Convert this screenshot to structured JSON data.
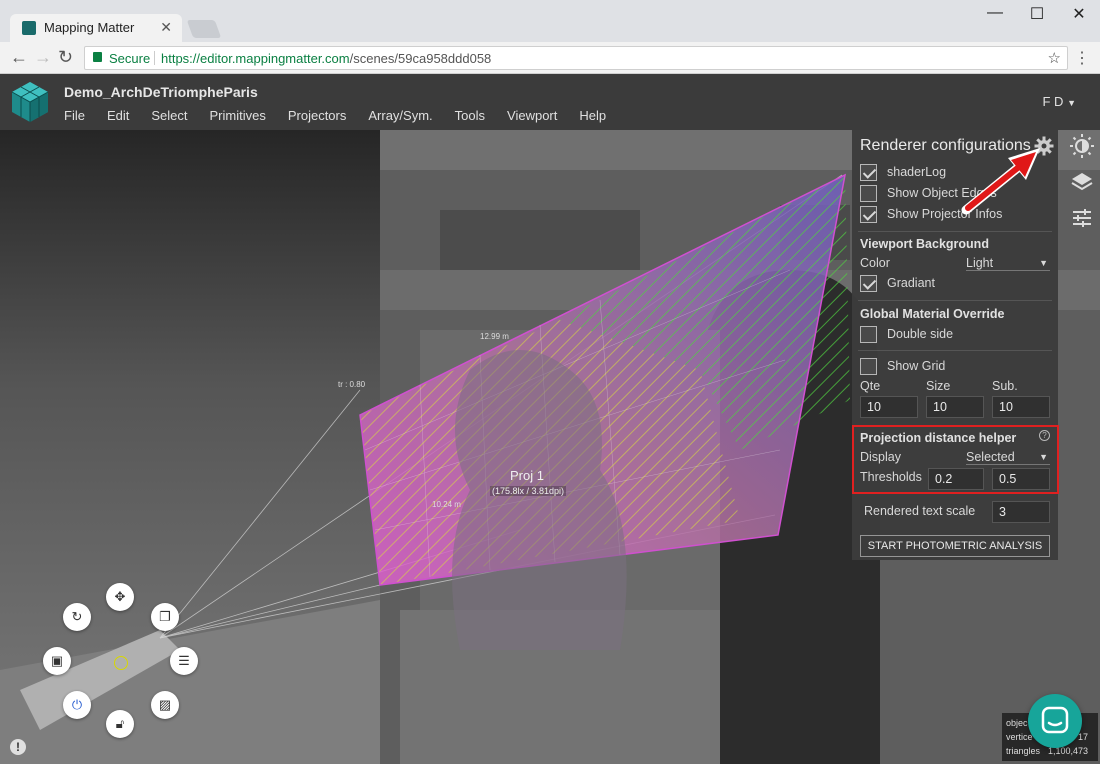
{
  "browser": {
    "tab_title": "Mapping Matter",
    "secure_label": "Secure",
    "url_host": "https://editor.mappingmatter.com",
    "url_path": "/scenes/59ca958ddd058",
    "minimize": "—",
    "maximize": "☐",
    "close": "✕"
  },
  "app": {
    "scene_title": "Demo_ArchDeTriompheParis",
    "user": "F D",
    "menu": [
      "File",
      "Edit",
      "Select",
      "Primitives",
      "Projectors",
      "Array/Sym.",
      "Tools",
      "Viewport",
      "Help"
    ]
  },
  "panel": {
    "title": "Renderer configurations",
    "options": [
      {
        "label": "shaderLog",
        "checked": true
      },
      {
        "label": "Show Object Edges",
        "checked": false
      },
      {
        "label": "Show Projector Infos",
        "checked": true
      }
    ],
    "viewport_background": {
      "title": "Viewport Background",
      "color_label": "Color",
      "color_value": "Light",
      "gradient_label": "Gradiant",
      "gradient_checked": true
    },
    "global_material": {
      "title": "Global Material Override",
      "double_side_label": "Double side",
      "double_side_checked": false
    },
    "grid": {
      "show_label": "Show Grid",
      "show_checked": false,
      "qte_label": "Qte",
      "size_label": "Size",
      "sub_label": "Sub.",
      "qte": "10",
      "size": "10",
      "sub": "10"
    },
    "projection_helper": {
      "title": "Projection distance helper",
      "display_label": "Display",
      "display_value": "Selected",
      "thresholds_label": "Thresholds",
      "threshold_1": "0.2",
      "threshold_2": "0.5"
    },
    "text_scale": {
      "label": "Rendered text scale",
      "value": "3"
    },
    "analysis_button": "START PHOTOMETRIC ANALYSIS"
  },
  "viewport": {
    "projector_name": "Proj 1",
    "projector_info": "(175.8lx / 3.81dpi)",
    "label_tr": "tr : 0.80",
    "label_distance": "12.99 m",
    "label_side": "10.24 m"
  },
  "stats": {
    "rows": [
      {
        "label": "objec",
        "value": ""
      },
      {
        "label": "vertice",
        "value": "17"
      },
      {
        "label": "triangles",
        "value": "1,100,473"
      }
    ]
  },
  "colors": {
    "accent": "#17a59a",
    "highlight": "#e02020",
    "arrow": "#e01818"
  }
}
